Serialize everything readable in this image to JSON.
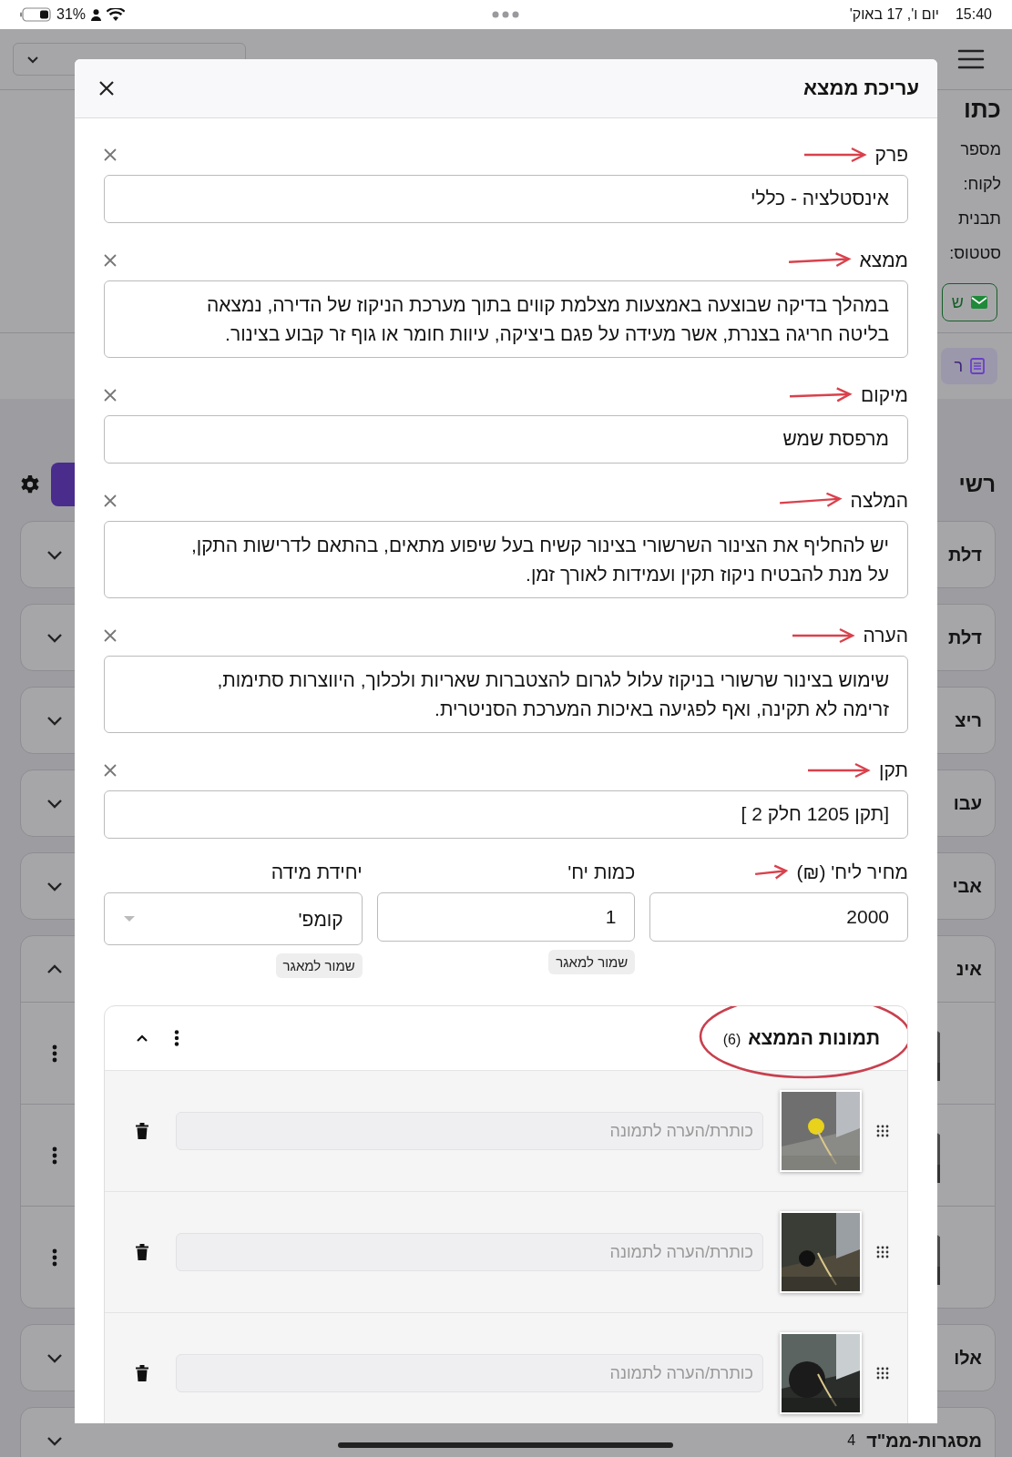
{
  "status_bar": {
    "time": "15:40",
    "date": "יום ו', 17 באוק'",
    "battery": "31%"
  },
  "background": {
    "title": "כתו",
    "info": [
      "מספר",
      "לקוח:",
      "תבנית",
      "סטטוס:"
    ],
    "send_button": "ש",
    "report_button": "ר",
    "list_title": "רשי",
    "cards": [
      {
        "label": "דלת",
        "expanded": false
      },
      {
        "label": "דלת",
        "expanded": false
      },
      {
        "label": "ריצ",
        "expanded": false
      },
      {
        "label": "עבו",
        "expanded": false
      },
      {
        "label": "אבי",
        "expanded": false
      },
      {
        "label": "אינ",
        "expanded": true
      },
      {
        "label": "אלו",
        "expanded": false
      },
      {
        "label": "מסגרות-ממ\"ד",
        "expanded": false,
        "count": "4"
      }
    ]
  },
  "modal": {
    "title": "עריכת ממצא",
    "fields": [
      {
        "label": "פרק",
        "kind": "input",
        "value": "אינסטלציה - כללי"
      },
      {
        "label": "ממצא",
        "kind": "textarea",
        "value": "במהלך בדיקה שבוצעה באמצעות מצלמת קווים בתוך מערכת הניקוז של הדירה, נמצאה בליטה חריגה בצנרת, אשר מעידה על פגם ביציקה, עיוות חומר או גוף זר קבוע בצינור."
      },
      {
        "label": "מיקום",
        "kind": "input",
        "value": "מרפסת שמש"
      },
      {
        "label": "המלצה",
        "kind": "textarea",
        "value": "יש להחליף את הצינור השרשורי בצינור קשיח בעל שיפוע מתאים, בהתאם לדרישות התקן, על מנת להבטיח ניקוז תקין ועמידות לאורך זמן."
      },
      {
        "label": "הערה",
        "kind": "textarea",
        "value": "שימוש בצינור שרשורי בניקוז עלול לגרום להצטברות שאריות ולכלוך, היווצרות סתימות, זרימה לא תקינה, ואף לפגיעה באיכות המערכת הסניטרית."
      },
      {
        "label": "תקן",
        "kind": "input",
        "value": "[תקן 1205 חלק 2 ]"
      }
    ],
    "price_row": [
      {
        "label": "מחיר ליח' (₪)",
        "kind": "input",
        "value": "2000",
        "arrow": true
      },
      {
        "label": "כמות יח'",
        "kind": "input",
        "value": "1",
        "chip": "שמור למאגר"
      },
      {
        "label": "יחידת מידה",
        "kind": "select",
        "value": "קומפ'",
        "chip": "שמור למאגר"
      }
    ],
    "photos": {
      "title": "תמונות הממצא",
      "count": "(6)",
      "expanded": true,
      "items": [
        {
          "placeholder": "כותרת/הערה לתמונה",
          "kind": "picture"
        },
        {
          "placeholder": "כותרת/הערה לתמונה",
          "kind": "picture"
        },
        {
          "placeholder": "כותרת/הערה לתמונה",
          "kind": "picture"
        }
      ]
    }
  }
}
